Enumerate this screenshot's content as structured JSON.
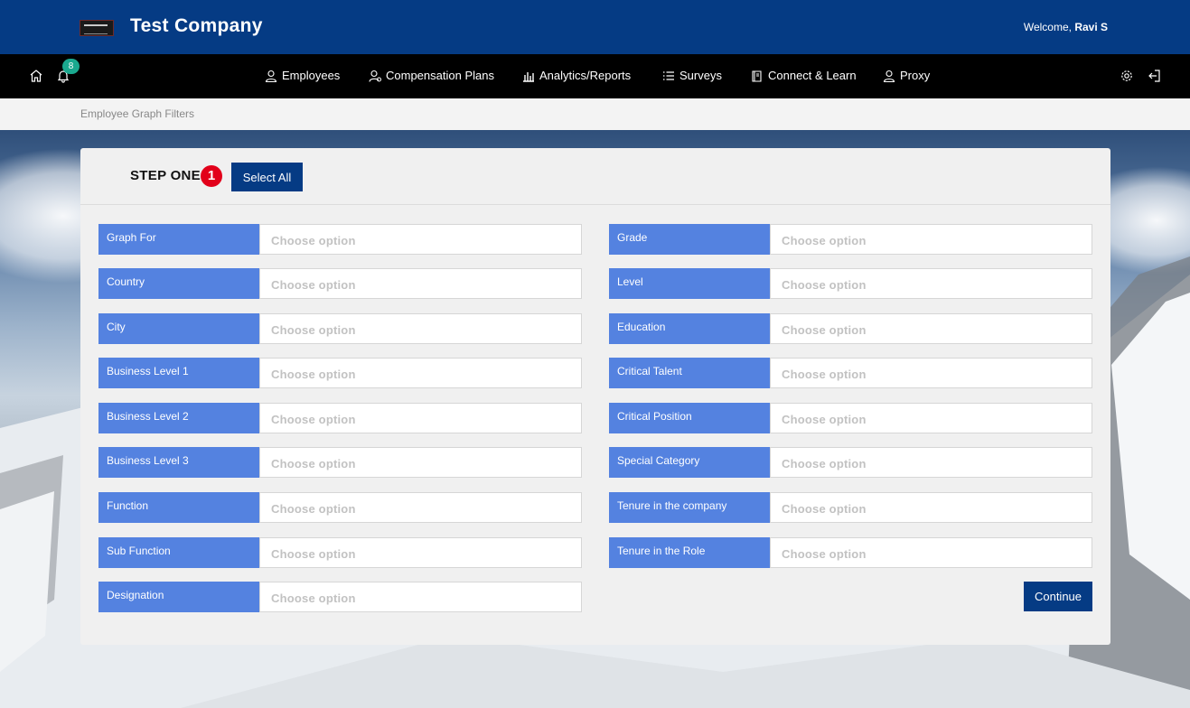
{
  "header": {
    "company": "Test Company",
    "welcome_prefix": "Welcome,",
    "user_name": "Ravi S"
  },
  "nav": {
    "notification_count": "8",
    "items": [
      {
        "label": "Employees",
        "icon": "user-icon"
      },
      {
        "label": "Compensation Plans",
        "icon": "user-money-icon"
      },
      {
        "label": "Analytics/Reports",
        "icon": "bar-chart-icon"
      },
      {
        "label": "Surveys",
        "icon": "list-icon"
      },
      {
        "label": "Connect & Learn",
        "icon": "book-icon"
      },
      {
        "label": "Proxy",
        "icon": "user-icon"
      }
    ]
  },
  "breadcrumb": "Employee Graph Filters",
  "step": {
    "title": "STEP ONE",
    "number": "1",
    "select_all": "Select All"
  },
  "placeholder": "Choose option",
  "left_fields": [
    "Graph For",
    "Country",
    "City",
    "Business Level 1",
    "Business Level 2",
    "Business Level 3",
    "Function",
    "Sub Function",
    "Designation"
  ],
  "right_fields": [
    "Grade",
    "Level",
    "Education",
    "Critical Talent",
    "Critical Position",
    "Special Category",
    "Tenure in the company",
    "Tenure in the Role"
  ],
  "continue_label": "Continue",
  "colors": {
    "header": "#053b84",
    "nav": "#000000",
    "label_bg": "#5482e0",
    "badge": "#1aa98f",
    "step_badge": "#e2001a"
  }
}
